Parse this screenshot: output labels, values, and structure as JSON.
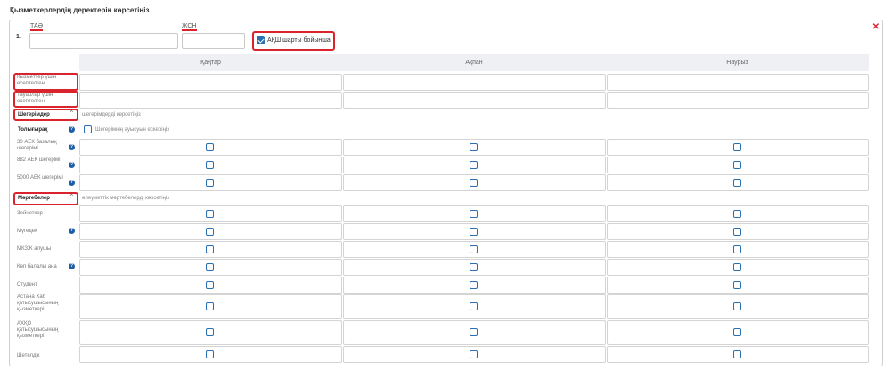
{
  "page_title": "Қызметкерлердің деректерін көрсетіңіз",
  "card": {
    "index": "1.",
    "close_icon": "close-icon",
    "fio_label": "ТАӘ",
    "iin_label": "ЖСН",
    "akch_checkbox_label": "АҚШ шарты бойынша",
    "akch_checked": true
  },
  "columns": [
    "Қаңтар",
    "Ақпан",
    "Наурыз"
  ],
  "income_rows": [
    {
      "label": "Қызметтер үшін есептелген"
    },
    {
      "label": "Тауарлар үшін есептелген"
    }
  ],
  "deductions": {
    "toggle_label": "Шегерімдер",
    "hint": "шегерімдерді көрсетіңіз",
    "full_label": "Толығырақ",
    "consider_label": "Шегерімнің ауысуын ескеріңіз",
    "rows": [
      {
        "label": "30 АЕК базалық шегерімі",
        "help": true
      },
      {
        "label": "882 АЕК шегерімі",
        "help": true
      },
      {
        "label": "5000 АЕК шегерімі",
        "help": true
      }
    ]
  },
  "statuses": {
    "toggle_label": "Мәртебелер",
    "hint": "әлеуметтік мәртебелерді көрсетіңіз",
    "rows": [
      {
        "label": "Зейнеткер",
        "help": false
      },
      {
        "label": "Мүгедек",
        "help": true
      },
      {
        "label": "МКЗЖ алушы",
        "help": false
      },
      {
        "label": "Көп балалы ана",
        "help": true
      },
      {
        "label": "Студент",
        "help": false
      },
      {
        "label": "Астана Хаб қатысушысының қызметкері",
        "help": false
      },
      {
        "label": "АХҚО қатысушысының қызметкері",
        "help": false
      },
      {
        "label": "Шетелдік",
        "help": false
      }
    ]
  },
  "help_glyph": "?",
  "chevron_glyph": "^"
}
